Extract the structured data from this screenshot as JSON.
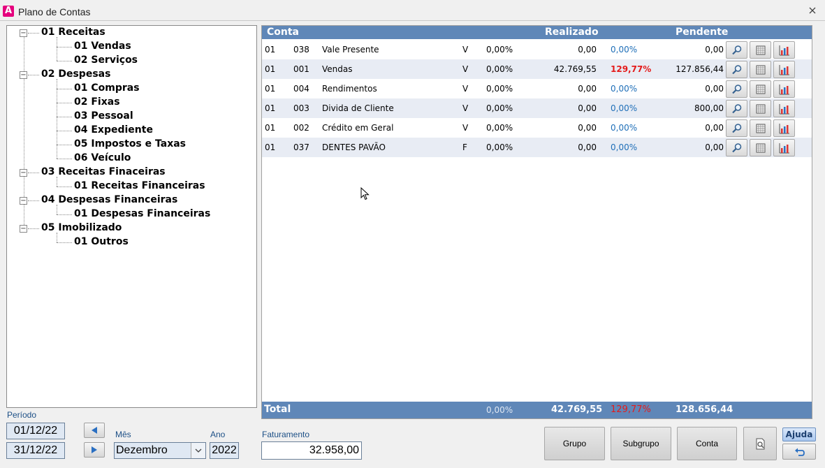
{
  "window": {
    "title": "Plano de Contas",
    "icon_letter": "A"
  },
  "tree": [
    {
      "label": "01 Receitas",
      "level": 0,
      "expanded": true
    },
    {
      "label": "01 Vendas",
      "level": 1
    },
    {
      "label": "02 Serviços",
      "level": 1
    },
    {
      "label": "02 Despesas",
      "level": 0,
      "expanded": true
    },
    {
      "label": "01 Compras",
      "level": 1
    },
    {
      "label": "02 Fixas",
      "level": 1
    },
    {
      "label": "03 Pessoal",
      "level": 1
    },
    {
      "label": "04 Expediente",
      "level": 1
    },
    {
      "label": "05 Impostos e Taxas",
      "level": 1
    },
    {
      "label": "06 Veículo",
      "level": 1
    },
    {
      "label": "03 Receitas Finaceiras",
      "level": 0,
      "expanded": true
    },
    {
      "label": "01 Receitas Financeiras",
      "level": 1
    },
    {
      "label": "04 Despesas Financeiras",
      "level": 0,
      "expanded": true
    },
    {
      "label": "01 Despesas Financeiras",
      "level": 1
    },
    {
      "label": "05 Imobilizado",
      "level": 0,
      "expanded": true
    },
    {
      "label": "01 Outros",
      "level": 1
    }
  ],
  "grid": {
    "headers": {
      "conta": "Conta",
      "realizado": "Realizado",
      "pendente": "Pendente"
    },
    "rows": [
      {
        "grupo": "01",
        "codigo": "038",
        "nome": "Vale Presente",
        "tipo": "V",
        "pct1": "0,00%",
        "realizado": "0,00",
        "pct2": "0,00%",
        "pct2_alert": false,
        "pendente": "0,00"
      },
      {
        "grupo": "01",
        "codigo": "001",
        "nome": "Vendas",
        "tipo": "V",
        "pct1": "0,00%",
        "realizado": "42.769,55",
        "pct2": "129,77%",
        "pct2_alert": true,
        "pendente": "127.856,44"
      },
      {
        "grupo": "01",
        "codigo": "004",
        "nome": "Rendimentos",
        "tipo": "V",
        "pct1": "0,00%",
        "realizado": "0,00",
        "pct2": "0,00%",
        "pct2_alert": false,
        "pendente": "0,00"
      },
      {
        "grupo": "01",
        "codigo": "003",
        "nome": "Divida de Cliente",
        "tipo": "V",
        "pct1": "0,00%",
        "realizado": "0,00",
        "pct2": "0,00%",
        "pct2_alert": false,
        "pendente": "800,00"
      },
      {
        "grupo": "01",
        "codigo": "002",
        "nome": "Crédito em Geral",
        "tipo": "V",
        "pct1": "0,00%",
        "realizado": "0,00",
        "pct2": "0,00%",
        "pct2_alert": false,
        "pendente": "0,00"
      },
      {
        "grupo": "01",
        "codigo": "037",
        "nome": "DENTES PAVÃO",
        "tipo": "F",
        "pct1": "0,00%",
        "realizado": "0,00",
        "pct2": "0,00%",
        "pct2_alert": false,
        "pendente": "0,00"
      }
    ],
    "footer": {
      "label": "Total",
      "pct1": "0,00%",
      "realizado": "42.769,55",
      "pct2": "129,77%",
      "pendente": "128.656,44"
    }
  },
  "period": {
    "label": "Período",
    "start": "01/12/22",
    "end": "31/12/22",
    "month_label": "Mês",
    "month": "Dezembro",
    "year_label": "Ano",
    "year": "2022"
  },
  "faturamento": {
    "label": "Faturamento",
    "value": "32.958,00"
  },
  "buttons": {
    "grupo": "Grupo",
    "subgrupo": "Subgrupo",
    "conta": "Conta",
    "ajuda": "Ajuda"
  },
  "colors": {
    "header_bg": "#5f87b8",
    "alert": "#e41b1b",
    "pct_blue": "#1f6fb8",
    "alt_row": "#e8ecf4"
  }
}
